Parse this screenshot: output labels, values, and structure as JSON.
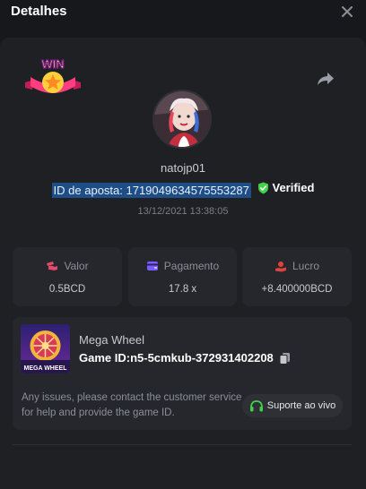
{
  "header": {
    "title": "Detalhes"
  },
  "win_badge": {
    "text": "WIN"
  },
  "user": {
    "username": "natojp01"
  },
  "bet": {
    "id_text": "ID de aposta: 1719049634575553287",
    "verified_label": "Verified",
    "timestamp": "13/12/2021 13:38:05"
  },
  "stats": [
    {
      "label": "Valor",
      "value": "0.5BCD",
      "icon": "wager-icon",
      "color": "#e24b6b"
    },
    {
      "label": "Pagamento",
      "value": "17.8 x",
      "icon": "wallet-icon",
      "color": "#7a5cff"
    },
    {
      "label": "Lucro",
      "value": "+8.400000BCD",
      "icon": "profit-icon",
      "color": "#e2423d"
    }
  ],
  "game": {
    "name": "Mega Wheel",
    "thumb_text": "MEGA WHEEL",
    "id_text": "Game ID:n5-5cmkub-372931402208",
    "support_text": "Any issues, please contact the customer service for help and provide the game ID.",
    "support_button_label": "Suporte ao vivo"
  },
  "colors": {
    "accent_green": "#3fd24a",
    "selection": "#1f4e86",
    "panel": "#1e2024",
    "card": "#25272c"
  }
}
